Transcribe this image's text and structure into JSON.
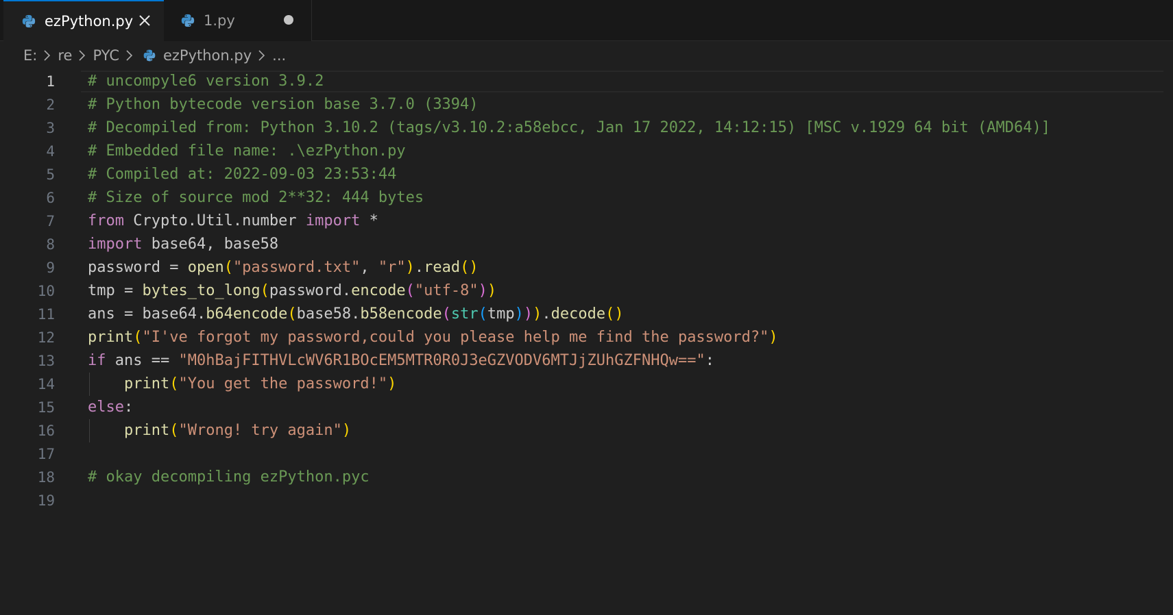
{
  "tabs": [
    {
      "label": "ezPython.py",
      "active": true,
      "icon": "python-icon",
      "action_icon": "close-icon"
    },
    {
      "label": "1.py",
      "active": false,
      "icon": "python-icon",
      "action_icon": "unsaved-dot-icon"
    }
  ],
  "breadcrumb": {
    "items": [
      "E:",
      "re",
      "PYC",
      "ezPython.py",
      "..."
    ],
    "separator_icon": "chevron-right-icon"
  },
  "editor": {
    "active_line": 1,
    "line_numbers": [
      "1",
      "2",
      "3",
      "4",
      "5",
      "6",
      "7",
      "8",
      "9",
      "10",
      "11",
      "12",
      "13",
      "14",
      "15",
      "16",
      "17",
      "18",
      "19"
    ],
    "lines": [
      [
        {
          "t": "# uncompyle6 version 3.9.2",
          "c": "com"
        }
      ],
      [
        {
          "t": "# Python bytecode version base 3.7.0 (3394)",
          "c": "com"
        }
      ],
      [
        {
          "t": "# Decompiled from: Python 3.10.2 (tags/v3.10.2:a58ebcc, Jan 17 2022, 14:12:15) [MSC v.1929 64 bit (AMD64)]",
          "c": "com"
        }
      ],
      [
        {
          "t": "# Embedded file name: .\\ezPython.py",
          "c": "com"
        }
      ],
      [
        {
          "t": "# Compiled at: 2022-09-03 23:53:44",
          "c": "com"
        }
      ],
      [
        {
          "t": "# Size of source mod 2**32: 444 bytes",
          "c": "com"
        }
      ],
      [
        {
          "t": "from",
          "c": "kw"
        },
        {
          "t": " Crypto.Util.number ",
          "c": "plain"
        },
        {
          "t": "import",
          "c": "kw"
        },
        {
          "t": " *",
          "c": "plain"
        }
      ],
      [
        {
          "t": "import",
          "c": "kw"
        },
        {
          "t": " base64, base58",
          "c": "plain"
        }
      ],
      [
        {
          "t": "password = ",
          "c": "plain"
        },
        {
          "t": "open",
          "c": "fn"
        },
        {
          "t": "(",
          "c": "b1"
        },
        {
          "t": "\"password.txt\"",
          "c": "str"
        },
        {
          "t": ", ",
          "c": "plain"
        },
        {
          "t": "\"r\"",
          "c": "str"
        },
        {
          "t": ")",
          "c": "b1"
        },
        {
          "t": ".",
          "c": "plain"
        },
        {
          "t": "read",
          "c": "fn"
        },
        {
          "t": "()",
          "c": "b1"
        }
      ],
      [
        {
          "t": "tmp = ",
          "c": "plain"
        },
        {
          "t": "bytes_to_long",
          "c": "fn"
        },
        {
          "t": "(",
          "c": "b1"
        },
        {
          "t": "password.",
          "c": "plain"
        },
        {
          "t": "encode",
          "c": "fn"
        },
        {
          "t": "(",
          "c": "b2"
        },
        {
          "t": "\"utf-8\"",
          "c": "str"
        },
        {
          "t": ")",
          "c": "b2"
        },
        {
          "t": ")",
          "c": "b1"
        }
      ],
      [
        {
          "t": "ans = base64.",
          "c": "plain"
        },
        {
          "t": "b64encode",
          "c": "fn"
        },
        {
          "t": "(",
          "c": "b1"
        },
        {
          "t": "base58.",
          "c": "plain"
        },
        {
          "t": "b58encode",
          "c": "fn"
        },
        {
          "t": "(",
          "c": "b2"
        },
        {
          "t": "str",
          "c": "type"
        },
        {
          "t": "(",
          "c": "b3"
        },
        {
          "t": "tmp",
          "c": "plain"
        },
        {
          "t": ")",
          "c": "b3"
        },
        {
          "t": ")",
          "c": "b2"
        },
        {
          "t": ")",
          "c": "b1"
        },
        {
          "t": ".",
          "c": "plain"
        },
        {
          "t": "decode",
          "c": "fn"
        },
        {
          "t": "()",
          "c": "b1"
        }
      ],
      [
        {
          "t": "print",
          "c": "fn"
        },
        {
          "t": "(",
          "c": "b1"
        },
        {
          "t": "\"I've forgot my password,could you please help me find the password?\"",
          "c": "str"
        },
        {
          "t": ")",
          "c": "b1"
        }
      ],
      [
        {
          "t": "if",
          "c": "kw"
        },
        {
          "t": " ans == ",
          "c": "plain"
        },
        {
          "t": "\"M0hBajFITHVLcWV6R1BOcEM5MTR0R0J3eGZVODV6MTJjZUhGZFNHQw==\"",
          "c": "str"
        },
        {
          "t": ":",
          "c": "plain"
        }
      ],
      [
        {
          "t": "    ",
          "c": "plain"
        },
        {
          "t": "print",
          "c": "fn"
        },
        {
          "t": "(",
          "c": "b1"
        },
        {
          "t": "\"You get the password!\"",
          "c": "str"
        },
        {
          "t": ")",
          "c": "b1"
        }
      ],
      [
        {
          "t": "else",
          "c": "kw"
        },
        {
          "t": ":",
          "c": "plain"
        }
      ],
      [
        {
          "t": "    ",
          "c": "plain"
        },
        {
          "t": "print",
          "c": "fn"
        },
        {
          "t": "(",
          "c": "b1"
        },
        {
          "t": "\"Wrong! try again\"",
          "c": "str"
        },
        {
          "t": ")",
          "c": "b1"
        }
      ],
      [],
      [
        {
          "t": "# okay decompiling ezPython.pyc",
          "c": "com"
        }
      ],
      []
    ],
    "indent_guide_lines": [
      14,
      16
    ]
  },
  "colors": {
    "background": "#1f1f1f",
    "tab_bar": "#181818",
    "accent": "#0078d4",
    "comment": "#6a9955",
    "keyword": "#c586c0",
    "string": "#ce9178",
    "function": "#dcdcaa"
  }
}
